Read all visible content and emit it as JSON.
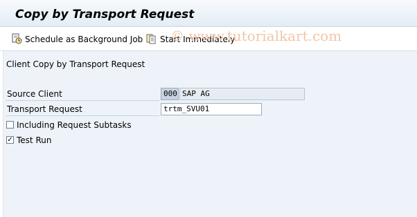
{
  "window": {
    "title": "Copy by Transport Request"
  },
  "toolbar": {
    "background_job_label": "Schedule as Background Job",
    "start_immediately_label": "Start Immediately"
  },
  "watermark": "© www.tutorialkart.com",
  "content": {
    "section_title": "Client Copy by Transport Request",
    "source_client": {
      "label": "Source Client",
      "code": "000",
      "name": "SAP AG"
    },
    "transport_request": {
      "label": "Transport Request",
      "value": "trtm_SVU01"
    },
    "including_subtasks": {
      "label": "Including Request Subtasks",
      "checked": false
    },
    "test_run": {
      "label": "Test Run",
      "checked": true
    }
  },
  "icons": {
    "background_job": "clock-document-icon",
    "start_immediately": "execute-document-icon"
  },
  "colors": {
    "accent": "#e3ecf5",
    "content_bg": "#eef3f9",
    "watermark": "#f3c6a4"
  }
}
